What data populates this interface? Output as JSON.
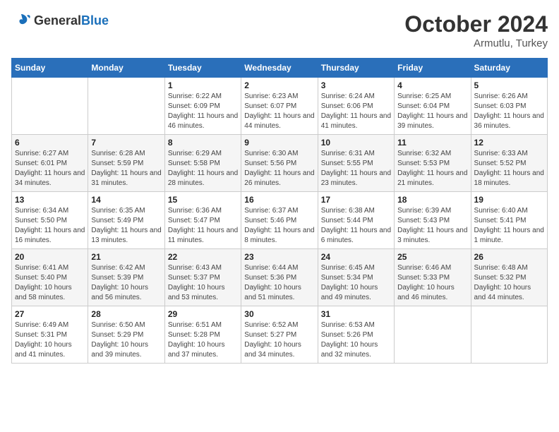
{
  "logo": {
    "general": "General",
    "blue": "Blue"
  },
  "header": {
    "month": "October 2024",
    "location": "Armutlu, Turkey"
  },
  "weekdays": [
    "Sunday",
    "Monday",
    "Tuesday",
    "Wednesday",
    "Thursday",
    "Friday",
    "Saturday"
  ],
  "weeks": [
    [
      {
        "day": "",
        "sunrise": "",
        "sunset": "",
        "daylight": ""
      },
      {
        "day": "",
        "sunrise": "",
        "sunset": "",
        "daylight": ""
      },
      {
        "day": "1",
        "sunrise": "Sunrise: 6:22 AM",
        "sunset": "Sunset: 6:09 PM",
        "daylight": "Daylight: 11 hours and 46 minutes."
      },
      {
        "day": "2",
        "sunrise": "Sunrise: 6:23 AM",
        "sunset": "Sunset: 6:07 PM",
        "daylight": "Daylight: 11 hours and 44 minutes."
      },
      {
        "day": "3",
        "sunrise": "Sunrise: 6:24 AM",
        "sunset": "Sunset: 6:06 PM",
        "daylight": "Daylight: 11 hours and 41 minutes."
      },
      {
        "day": "4",
        "sunrise": "Sunrise: 6:25 AM",
        "sunset": "Sunset: 6:04 PM",
        "daylight": "Daylight: 11 hours and 39 minutes."
      },
      {
        "day": "5",
        "sunrise": "Sunrise: 6:26 AM",
        "sunset": "Sunset: 6:03 PM",
        "daylight": "Daylight: 11 hours and 36 minutes."
      }
    ],
    [
      {
        "day": "6",
        "sunrise": "Sunrise: 6:27 AM",
        "sunset": "Sunset: 6:01 PM",
        "daylight": "Daylight: 11 hours and 34 minutes."
      },
      {
        "day": "7",
        "sunrise": "Sunrise: 6:28 AM",
        "sunset": "Sunset: 5:59 PM",
        "daylight": "Daylight: 11 hours and 31 minutes."
      },
      {
        "day": "8",
        "sunrise": "Sunrise: 6:29 AM",
        "sunset": "Sunset: 5:58 PM",
        "daylight": "Daylight: 11 hours and 28 minutes."
      },
      {
        "day": "9",
        "sunrise": "Sunrise: 6:30 AM",
        "sunset": "Sunset: 5:56 PM",
        "daylight": "Daylight: 11 hours and 26 minutes."
      },
      {
        "day": "10",
        "sunrise": "Sunrise: 6:31 AM",
        "sunset": "Sunset: 5:55 PM",
        "daylight": "Daylight: 11 hours and 23 minutes."
      },
      {
        "day": "11",
        "sunrise": "Sunrise: 6:32 AM",
        "sunset": "Sunset: 5:53 PM",
        "daylight": "Daylight: 11 hours and 21 minutes."
      },
      {
        "day": "12",
        "sunrise": "Sunrise: 6:33 AM",
        "sunset": "Sunset: 5:52 PM",
        "daylight": "Daylight: 11 hours and 18 minutes."
      }
    ],
    [
      {
        "day": "13",
        "sunrise": "Sunrise: 6:34 AM",
        "sunset": "Sunset: 5:50 PM",
        "daylight": "Daylight: 11 hours and 16 minutes."
      },
      {
        "day": "14",
        "sunrise": "Sunrise: 6:35 AM",
        "sunset": "Sunset: 5:49 PM",
        "daylight": "Daylight: 11 hours and 13 minutes."
      },
      {
        "day": "15",
        "sunrise": "Sunrise: 6:36 AM",
        "sunset": "Sunset: 5:47 PM",
        "daylight": "Daylight: 11 hours and 11 minutes."
      },
      {
        "day": "16",
        "sunrise": "Sunrise: 6:37 AM",
        "sunset": "Sunset: 5:46 PM",
        "daylight": "Daylight: 11 hours and 8 minutes."
      },
      {
        "day": "17",
        "sunrise": "Sunrise: 6:38 AM",
        "sunset": "Sunset: 5:44 PM",
        "daylight": "Daylight: 11 hours and 6 minutes."
      },
      {
        "day": "18",
        "sunrise": "Sunrise: 6:39 AM",
        "sunset": "Sunset: 5:43 PM",
        "daylight": "Daylight: 11 hours and 3 minutes."
      },
      {
        "day": "19",
        "sunrise": "Sunrise: 6:40 AM",
        "sunset": "Sunset: 5:41 PM",
        "daylight": "Daylight: 11 hours and 1 minute."
      }
    ],
    [
      {
        "day": "20",
        "sunrise": "Sunrise: 6:41 AM",
        "sunset": "Sunset: 5:40 PM",
        "daylight": "Daylight: 10 hours and 58 minutes."
      },
      {
        "day": "21",
        "sunrise": "Sunrise: 6:42 AM",
        "sunset": "Sunset: 5:39 PM",
        "daylight": "Daylight: 10 hours and 56 minutes."
      },
      {
        "day": "22",
        "sunrise": "Sunrise: 6:43 AM",
        "sunset": "Sunset: 5:37 PM",
        "daylight": "Daylight: 10 hours and 53 minutes."
      },
      {
        "day": "23",
        "sunrise": "Sunrise: 6:44 AM",
        "sunset": "Sunset: 5:36 PM",
        "daylight": "Daylight: 10 hours and 51 minutes."
      },
      {
        "day": "24",
        "sunrise": "Sunrise: 6:45 AM",
        "sunset": "Sunset: 5:34 PM",
        "daylight": "Daylight: 10 hours and 49 minutes."
      },
      {
        "day": "25",
        "sunrise": "Sunrise: 6:46 AM",
        "sunset": "Sunset: 5:33 PM",
        "daylight": "Daylight: 10 hours and 46 minutes."
      },
      {
        "day": "26",
        "sunrise": "Sunrise: 6:48 AM",
        "sunset": "Sunset: 5:32 PM",
        "daylight": "Daylight: 10 hours and 44 minutes."
      }
    ],
    [
      {
        "day": "27",
        "sunrise": "Sunrise: 6:49 AM",
        "sunset": "Sunset: 5:31 PM",
        "daylight": "Daylight: 10 hours and 41 minutes."
      },
      {
        "day": "28",
        "sunrise": "Sunrise: 6:50 AM",
        "sunset": "Sunset: 5:29 PM",
        "daylight": "Daylight: 10 hours and 39 minutes."
      },
      {
        "day": "29",
        "sunrise": "Sunrise: 6:51 AM",
        "sunset": "Sunset: 5:28 PM",
        "daylight": "Daylight: 10 hours and 37 minutes."
      },
      {
        "day": "30",
        "sunrise": "Sunrise: 6:52 AM",
        "sunset": "Sunset: 5:27 PM",
        "daylight": "Daylight: 10 hours and 34 minutes."
      },
      {
        "day": "31",
        "sunrise": "Sunrise: 6:53 AM",
        "sunset": "Sunset: 5:26 PM",
        "daylight": "Daylight: 10 hours and 32 minutes."
      },
      {
        "day": "",
        "sunrise": "",
        "sunset": "",
        "daylight": ""
      },
      {
        "day": "",
        "sunrise": "",
        "sunset": "",
        "daylight": ""
      }
    ]
  ]
}
